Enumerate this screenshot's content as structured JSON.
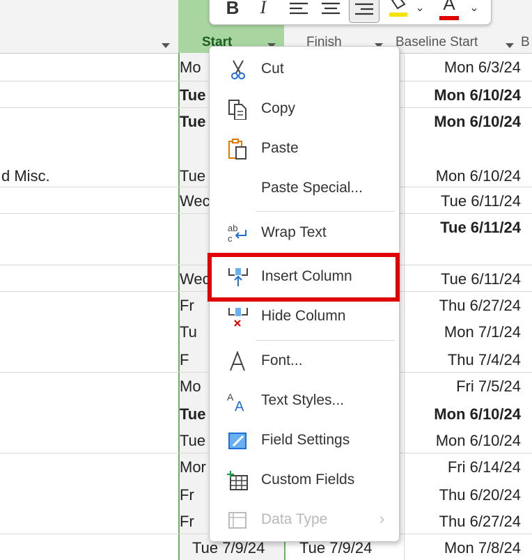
{
  "header": {
    "start_label": "Start",
    "finish_label": "Finish",
    "baseline_label": "Baseline Start",
    "extra_label": "B"
  },
  "toolbar": {
    "bold": "B",
    "italic": "I",
    "font_color_letter": "A",
    "fill_color": "#f5e400",
    "font_color": "#e00000"
  },
  "rows": [
    {
      "name": "",
      "start": "Mo",
      "baseline": "Mon 6/3/24",
      "bold": false
    },
    {
      "name": "",
      "start": "Tue",
      "baseline": "Mon 6/10/24",
      "bold": true
    },
    {
      "name": "",
      "start": "Tue",
      "baseline": "Mon 6/10/24",
      "bold": true
    },
    {
      "name": "d Misc.",
      "start": "Tue",
      "baseline": "Mon 6/10/24",
      "bold": false
    },
    {
      "name": "",
      "start": "Wec",
      "baseline": "Tue 6/11/24",
      "bold": false
    },
    {
      "name": "",
      "start": "",
      "baseline": "Tue 6/11/24",
      "bold": true
    },
    {
      "name": "",
      "start": "Wec",
      "baseline": "Tue 6/11/24",
      "bold": false
    },
    {
      "name": "",
      "start": "Fr",
      "baseline": "Thu 6/27/24",
      "bold": false
    },
    {
      "name": "",
      "start": "Tu",
      "baseline": "Mon 7/1/24",
      "bold": false
    },
    {
      "name": "",
      "start": "F",
      "baseline": "Thu 7/4/24",
      "bold": false
    },
    {
      "name": "",
      "start": "Mo",
      "baseline": "Fri 7/5/24",
      "bold": false
    },
    {
      "name": "",
      "start": "Tue",
      "baseline": "Mon 6/10/24",
      "bold": true
    },
    {
      "name": "",
      "start": "Tue",
      "baseline": "Mon 6/10/24",
      "bold": false
    },
    {
      "name": "",
      "start": "Mor",
      "baseline": "Fri 6/14/24",
      "bold": false
    },
    {
      "name": "",
      "start": "Fr",
      "baseline": "Thu 6/20/24",
      "bold": false
    },
    {
      "name": "",
      "start": "Fr",
      "baseline": "Thu 6/27/24",
      "bold": false
    },
    {
      "name": "",
      "start": "Tue 7/9/24",
      "finish": "Tue 7/9/24",
      "baseline": "Mon 7/8/24",
      "bold": false
    }
  ],
  "menu": {
    "cut": "Cut",
    "copy": "Copy",
    "paste": "Paste",
    "paste_special": "Paste Special...",
    "wrap_text": "Wrap Text",
    "insert_column": "Insert Column",
    "hide_column": "Hide Column",
    "font": "Font...",
    "text_styles": "Text Styles...",
    "field_settings": "Field Settings",
    "custom_fields": "Custom Fields",
    "data_type": "Data Type"
  },
  "colors": {
    "highlight": "#e00000",
    "start_header": "#a9d6a0",
    "accent_blue": "#1e6fd9",
    "accent_orange": "#e07b00"
  }
}
